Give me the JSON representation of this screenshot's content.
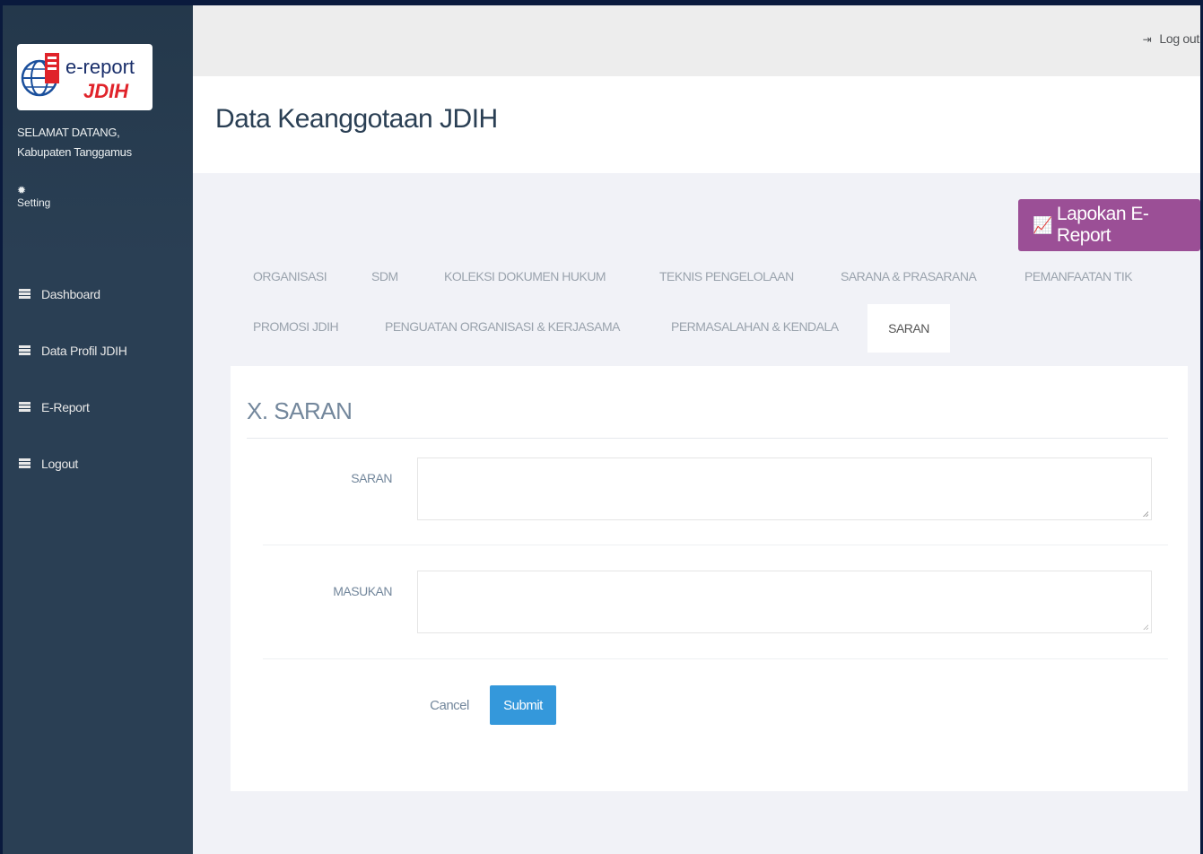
{
  "colors": {
    "sidebar": "#2a3f54",
    "accent_purple": "#9b4f96",
    "accent_blue": "#3498db",
    "logo_red": "#e0232a"
  },
  "logo": {
    "line1": "e-report",
    "line2": "JDIH"
  },
  "sidebar": {
    "welcome": "SELAMAT DATANG,",
    "user": "Kabupaten Tanggamus",
    "setting_label": "Setting",
    "items": [
      {
        "label": "Dashboard",
        "icon": "grid-icon"
      },
      {
        "label": "Data Profil JDIH",
        "icon": "grid-icon"
      },
      {
        "label": "E-Report",
        "icon": "grid-icon"
      },
      {
        "label": "Logout",
        "icon": "grid-icon"
      }
    ]
  },
  "topbar": {
    "logout_label": "Log out"
  },
  "header": {
    "title": "Data Keanggotaan JDIH"
  },
  "report_button": {
    "label": "Lapokan E-Report"
  },
  "tabs": {
    "row1": [
      "ORGANISASI",
      "SDM",
      "KOLEKSI DOKUMEN HUKUM",
      "TEKNIS PENGELOLAAN",
      "SARANA & PRASARANA",
      "PEMANFAATAN TIK"
    ],
    "row2": [
      "PROMOSI JDIH",
      "PENGUATAN ORGANISASI & KERJASAMA",
      "PERMASALAHAN & KENDALA"
    ],
    "active": "SARAN"
  },
  "form": {
    "section_title": "X. SARAN",
    "fields": [
      {
        "label": "SARAN",
        "value": ""
      },
      {
        "label": "MASUKAN",
        "value": ""
      }
    ],
    "cancel_label": "Cancel",
    "submit_label": "Submit"
  }
}
